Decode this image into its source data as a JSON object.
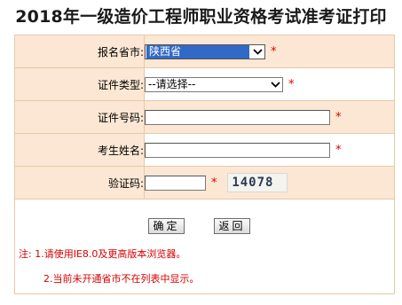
{
  "title": "2018年一级造价工程师职业资格考试准考证打印",
  "form": {
    "province_label": "报名省市:",
    "province_value": "陕西省",
    "cert_type_label": "证件类型:",
    "cert_type_value": "--请选择--",
    "cert_no_label": "证件号码:",
    "name_label": "考生姓名:",
    "captcha_label": "验证码:",
    "captcha_text": "14078",
    "required_mark": "*"
  },
  "buttons": {
    "confirm": "确定",
    "back": "返回"
  },
  "notes": {
    "line1": "注: 1.请使用IE8.0及更高版本浏览器。",
    "line2": "2.当前未开通省市不在列表中显示。"
  },
  "colors": {
    "label_bg": "#fbe7d3",
    "border": "#e6c9a8",
    "required": "#e00000",
    "selected_option_bg": "#3169c6"
  }
}
